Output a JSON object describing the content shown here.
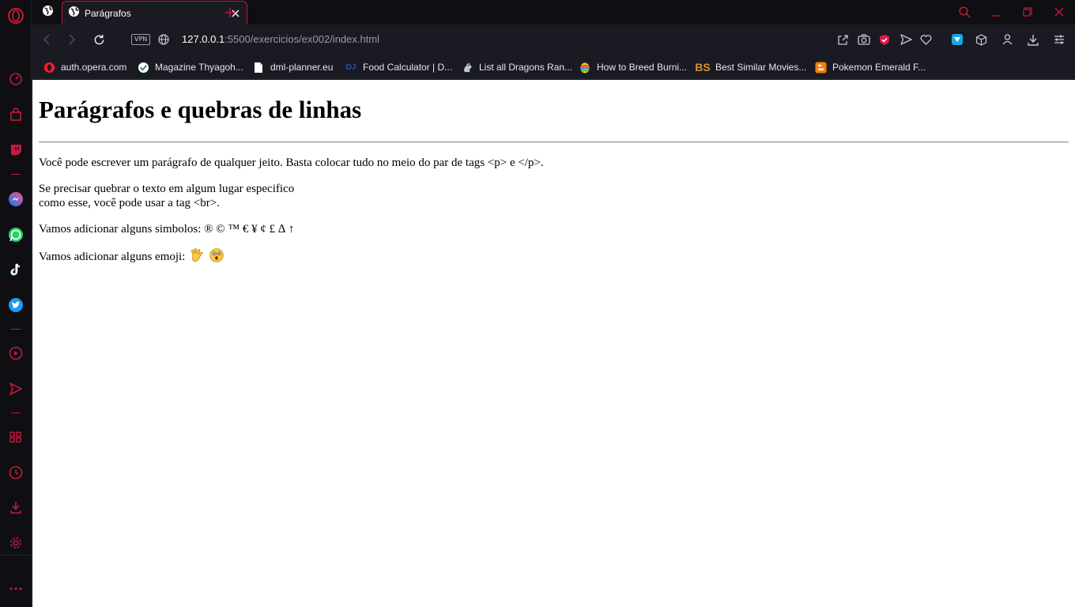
{
  "browser": {
    "active_tab_title": "Parágrafos",
    "url_host": "127.0.0.1",
    "url_path": ":5500/exercicios/ex002/index.html",
    "vpn_label": "VPN",
    "accent_color": "#c41a3a"
  },
  "bookmarks": [
    {
      "label": "auth.opera.com",
      "icon": "opera-icon"
    },
    {
      "label": "Magazine Thyagoh...",
      "icon": "check-badge-icon"
    },
    {
      "label": "dml-planner.eu",
      "icon": "file-icon"
    },
    {
      "label": "Food Calculator | D...",
      "icon": "dj-icon",
      "icon_text": "DJ"
    },
    {
      "label": "List all Dragons Ran...",
      "icon": "dragon-icon"
    },
    {
      "label": "How to Breed Burni...",
      "icon": "rainbow-egg-icon"
    },
    {
      "label": "Best Similar Movies...",
      "icon": "bs-icon",
      "icon_text": "BS"
    },
    {
      "label": "Pokemon Emerald F...",
      "icon": "blogger-icon"
    }
  ],
  "page": {
    "heading": "Parágrafos e quebras de linhas",
    "p1": "Você pode escrever um parágrafo de qualquer jeito. Basta colocar tudo no meio do par de tags <p> e </p>.",
    "p2_line1": "Se precisar quebrar o texto em algum lugar especifico",
    "p2_line2": "como esse, você pode usar a tag <br>.",
    "p3": "Vamos adicionar alguns simbolos: ® © ™ € ¥ ¢ £ ∆ ↑",
    "p4": "Vamos adicionar alguns emoji:"
  }
}
